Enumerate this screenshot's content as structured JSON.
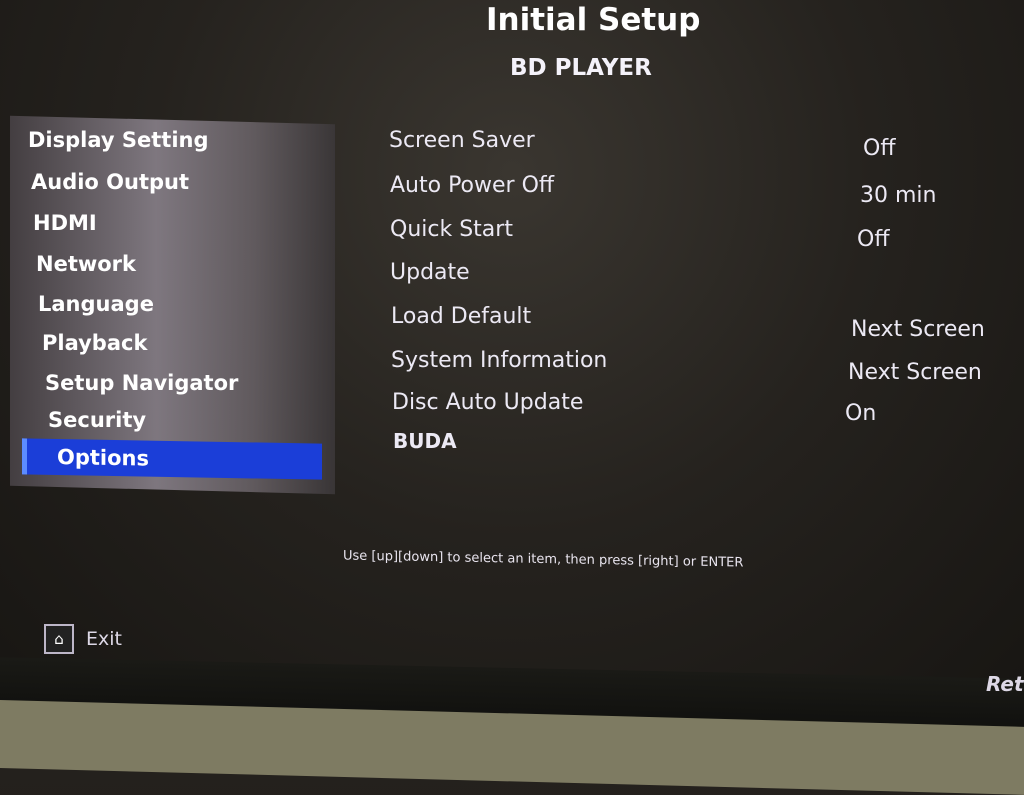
{
  "header": {
    "title": "Initial Setup",
    "subtitle": "BD PLAYER"
  },
  "sidebar": {
    "items": [
      {
        "label": "Display Setting"
      },
      {
        "label": "Audio Output"
      },
      {
        "label": "HDMI"
      },
      {
        "label": "Network"
      },
      {
        "label": "Language"
      },
      {
        "label": "Playback"
      },
      {
        "label": "Setup Navigator"
      },
      {
        "label": "Security"
      },
      {
        "label": "Options",
        "selected": true
      }
    ]
  },
  "options": [
    {
      "label": "Screen Saver",
      "value": "Off"
    },
    {
      "label": "Auto Power Off",
      "value": "30 min"
    },
    {
      "label": "Quick Start",
      "value": "Off"
    },
    {
      "label": "Update",
      "value": ""
    },
    {
      "label": "Load Default",
      "value": "Next Screen"
    },
    {
      "label": "System Information",
      "value": "Next Screen"
    },
    {
      "label": "Disc Auto Update",
      "value": "On"
    },
    {
      "label": "BUDA",
      "value": ""
    }
  ],
  "hint": "Use [up][down] to select an item, then press [right] or ENTER",
  "footer": {
    "exit_label": "Exit",
    "exit_icon": "home-icon",
    "return_label": "Ret"
  },
  "colors": {
    "selection": "#1b3ed8"
  }
}
